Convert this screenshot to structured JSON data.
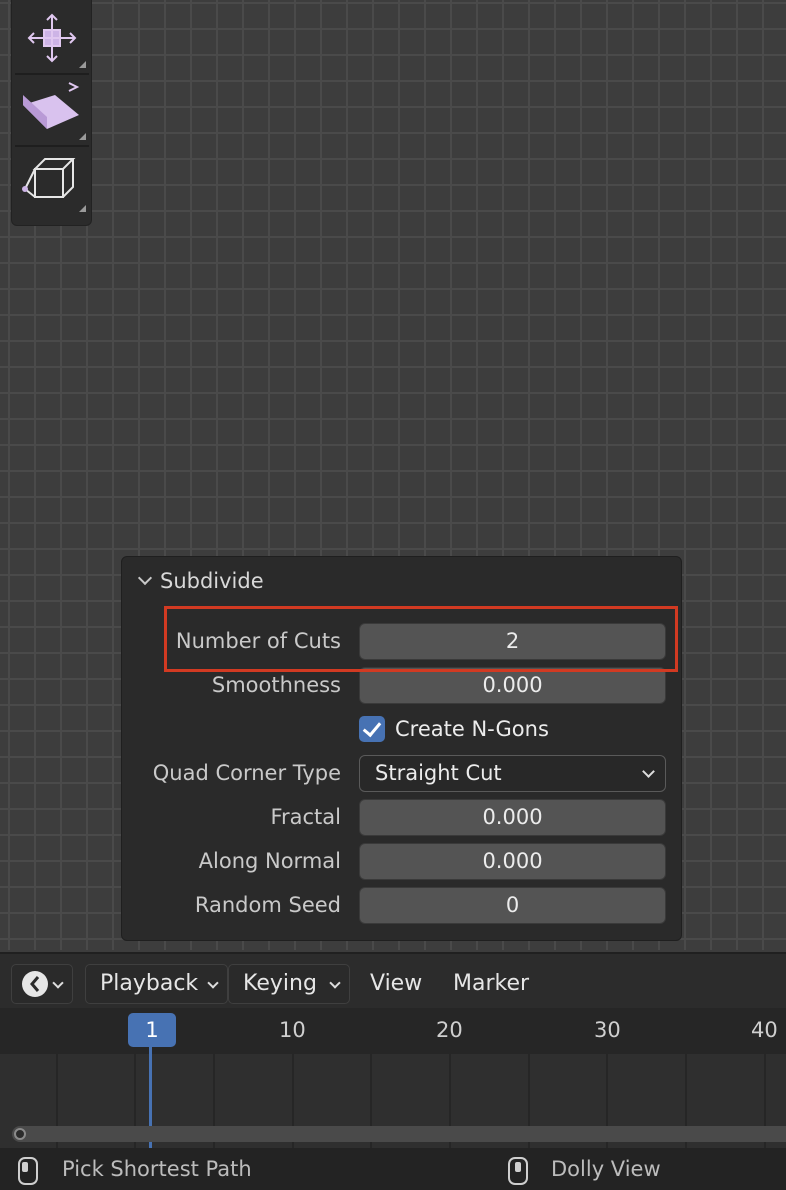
{
  "operator_panel": {
    "title": "Subdivide",
    "number_of_cuts": {
      "label": "Number of Cuts",
      "value": "2"
    },
    "smoothness": {
      "label": "Smoothness",
      "value": "0.000"
    },
    "create_ngons": {
      "label": "Create N-Gons",
      "checked": true
    },
    "quad_corner_type": {
      "label": "Quad Corner Type",
      "value": "Straight Cut"
    },
    "fractal": {
      "label": "Fractal",
      "value": "0.000"
    },
    "along_normal": {
      "label": "Along Normal",
      "value": "0.000"
    },
    "random_seed": {
      "label": "Random Seed",
      "value": "0"
    }
  },
  "toolbar": {
    "tools": [
      "transform-tool-icon",
      "extrude-tool-icon",
      "inset-cube-tool-icon"
    ]
  },
  "timeline": {
    "menu": {
      "playback": "Playback",
      "keying": "Keying",
      "view": "View",
      "marker": "Marker"
    },
    "current_frame": "1",
    "ticks": [
      "10",
      "20",
      "30",
      "40"
    ]
  },
  "statusbar": {
    "left_hint": "Pick Shortest Path",
    "right_hint": "Dolly View"
  },
  "colors": {
    "accent": "#4772b3",
    "highlight_box": "#d23a22"
  }
}
